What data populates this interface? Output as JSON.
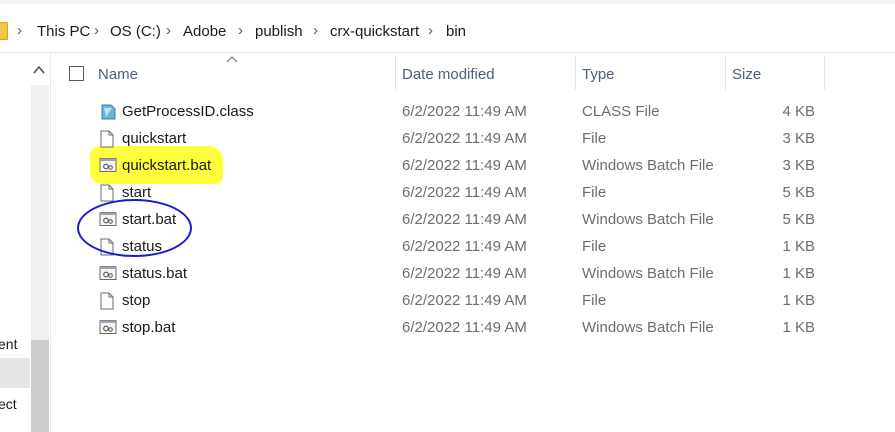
{
  "address": {
    "crumbs": [
      "This PC",
      "OS (C:)",
      "Adobe",
      "publish",
      "crx-quickstart",
      "bin"
    ],
    "separator": "›"
  },
  "nav": {
    "items": [
      "ent",
      "ect"
    ]
  },
  "columns": {
    "name": "Name",
    "date": "Date modified",
    "type": "Type",
    "size": "Size"
  },
  "files": [
    {
      "name": "GetProcessID.class",
      "date": "6/2/2022 11:49 AM",
      "type": "CLASS File",
      "size": "4 KB",
      "icon": "class-file-icon"
    },
    {
      "name": "quickstart",
      "date": "6/2/2022 11:49 AM",
      "type": "File",
      "size": "3 KB",
      "icon": "file-icon"
    },
    {
      "name": "quickstart.bat",
      "date": "6/2/2022 11:49 AM",
      "type": "Windows Batch File",
      "size": "3 KB",
      "icon": "batch-file-icon"
    },
    {
      "name": "start",
      "date": "6/2/2022 11:49 AM",
      "type": "File",
      "size": "5 KB",
      "icon": "file-icon"
    },
    {
      "name": "start.bat",
      "date": "6/2/2022 11:49 AM",
      "type": "Windows Batch File",
      "size": "5 KB",
      "icon": "batch-file-icon"
    },
    {
      "name": "status",
      "date": "6/2/2022 11:49 AM",
      "type": "File",
      "size": "1 KB",
      "icon": "file-icon"
    },
    {
      "name": "status.bat",
      "date": "6/2/2022 11:49 AM",
      "type": "Windows Batch File",
      "size": "1 KB",
      "icon": "batch-file-icon"
    },
    {
      "name": "stop",
      "date": "6/2/2022 11:49 AM",
      "type": "File",
      "size": "1 KB",
      "icon": "file-icon"
    },
    {
      "name": "stop.bat",
      "date": "6/2/2022 11:49 AM",
      "type": "Windows Batch File",
      "size": "1 KB",
      "icon": "batch-file-icon"
    }
  ],
  "annotations": {
    "highlight_color": "#ffff2e",
    "circle_color": "#1b1bc9"
  }
}
